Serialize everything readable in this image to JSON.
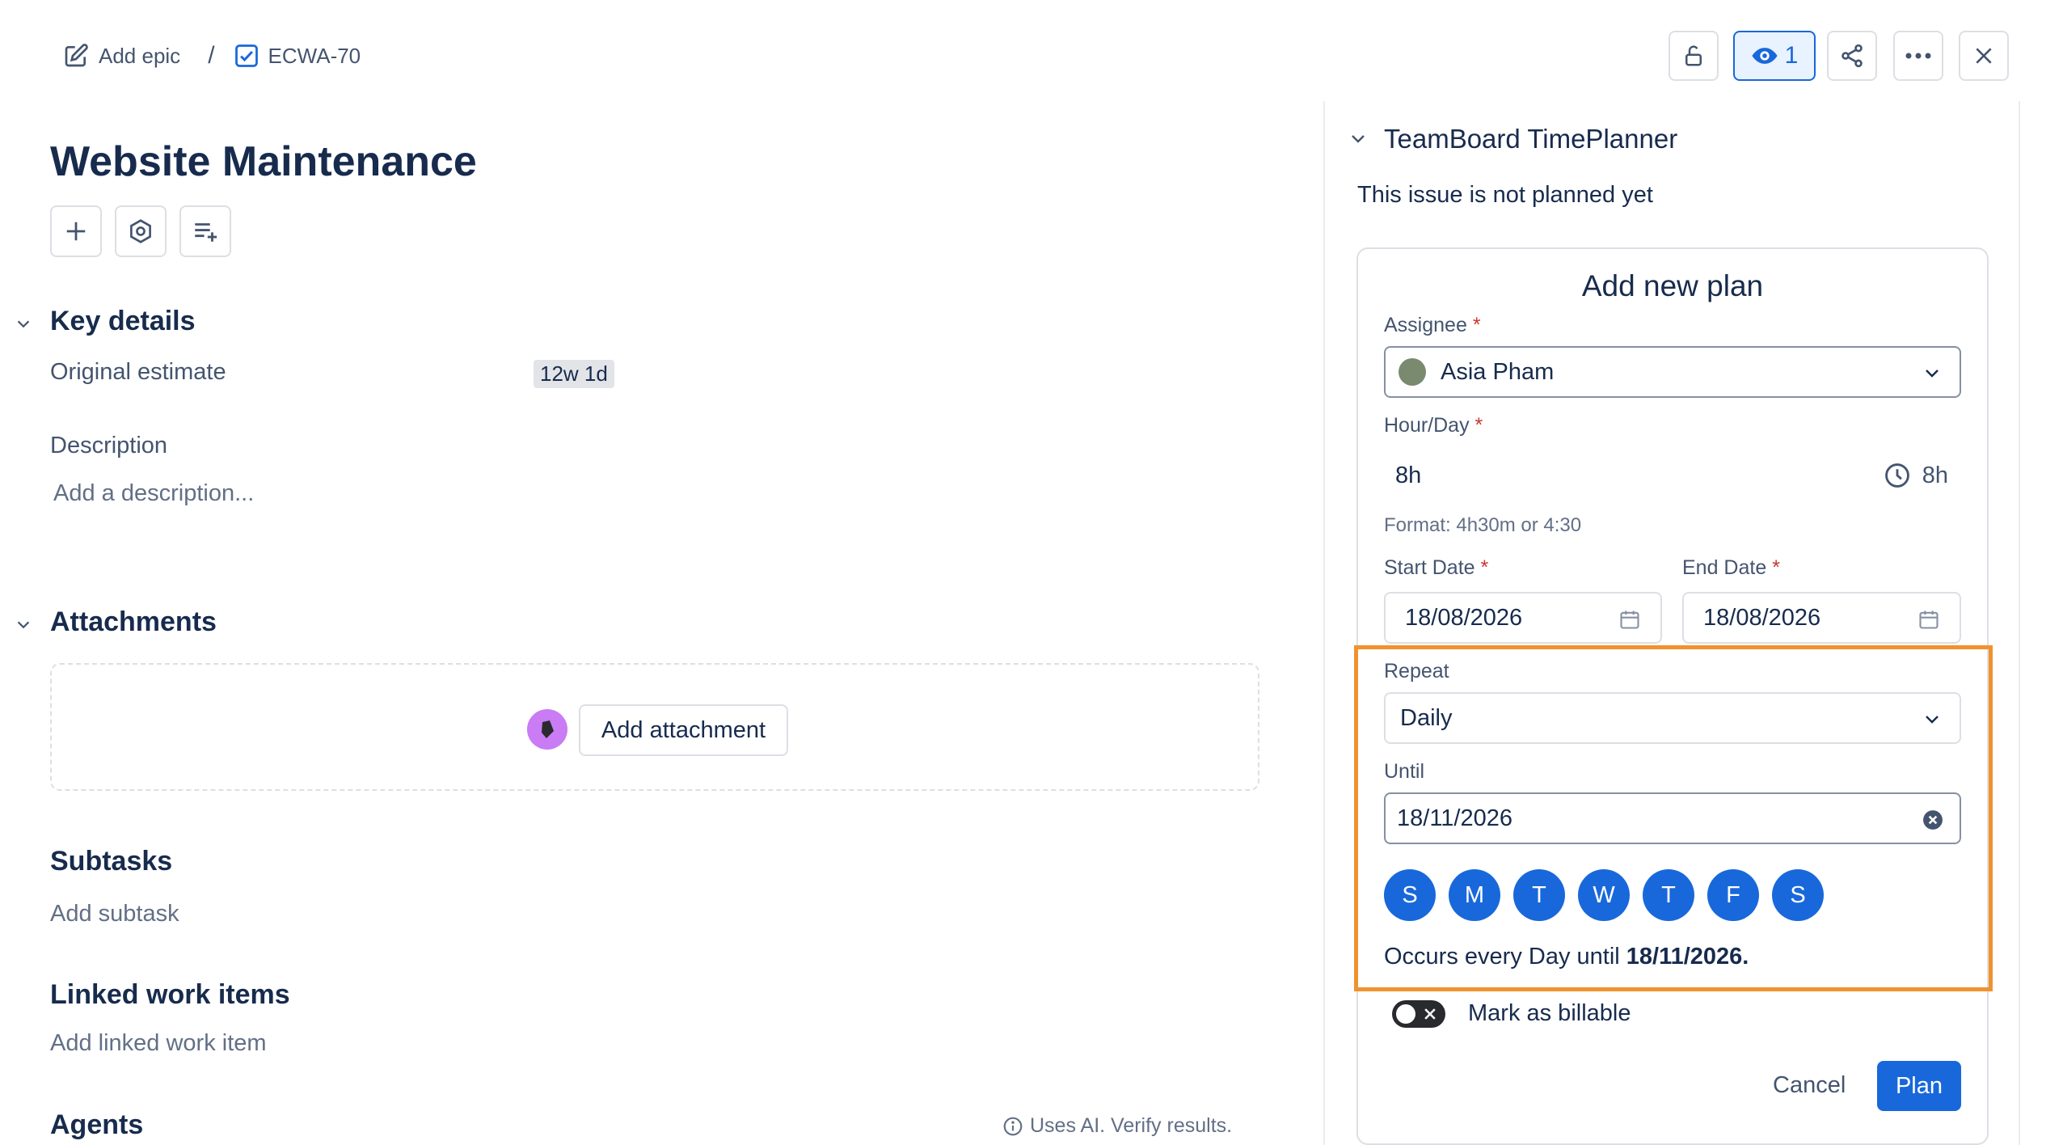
{
  "breadcrumb": {
    "add_epic_label": "Add epic",
    "separator": "/",
    "issue_key": "ECWA-70"
  },
  "header_actions": {
    "watch_count": "1"
  },
  "issue": {
    "title": "Website Maintenance"
  },
  "key_details": {
    "heading": "Key details",
    "original_estimate_label": "Original estimate",
    "original_estimate_value": "12w 1d"
  },
  "description": {
    "label": "Description",
    "placeholder": "Add a description..."
  },
  "attachments": {
    "heading": "Attachments",
    "add_button": "Add attachment"
  },
  "subtasks": {
    "heading": "Subtasks",
    "add_link": "Add subtask"
  },
  "linked_items": {
    "heading": "Linked work items",
    "add_link": "Add linked work item"
  },
  "agents": {
    "heading": "Agents",
    "ai_notice": "Uses AI. Verify results."
  },
  "timeplanner": {
    "heading": "TeamBoard TimePlanner",
    "status": "This issue is not planned yet",
    "card_title": "Add new plan",
    "assignee_label": "Assignee",
    "assignee_value": "Asia Pham",
    "hour_day_label": "Hour/Day",
    "hour_day_value": "8h",
    "hour_day_display": "8h",
    "format_hint": "Format: 4h30m or 4:30",
    "start_date_label": "Start Date",
    "start_date_value": "18/08/2026",
    "end_date_label": "End Date",
    "end_date_value": "18/08/2026",
    "repeat_label": "Repeat",
    "repeat_value": "Daily",
    "until_label": "Until",
    "until_value": "18/11/2026",
    "days": [
      "S",
      "M",
      "T",
      "W",
      "T",
      "F",
      "S"
    ],
    "summary_prefix": "Occurs every Day until ",
    "summary_date": "18/11/2026.",
    "billable_label": "Mark as billable",
    "cancel_button": "Cancel",
    "plan_button": "Plan",
    "required_mark": "*"
  },
  "colors": {
    "accent": "#1868db",
    "highlight": "#f0922e",
    "required": "#c9372c"
  }
}
